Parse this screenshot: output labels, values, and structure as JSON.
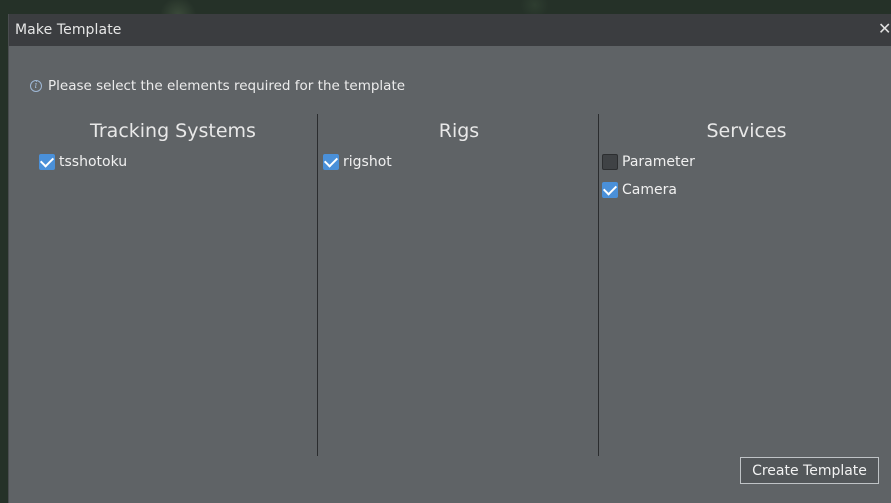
{
  "dialog": {
    "title": "Make Template",
    "close_glyph": "✕"
  },
  "info": {
    "icon": "info-icon",
    "glyph": "i",
    "text": "Please select the elements required for the template"
  },
  "columns": [
    {
      "header": "Tracking Systems",
      "items": [
        {
          "label": "tsshotoku",
          "checked": true
        }
      ]
    },
    {
      "header": "Rigs",
      "items": [
        {
          "label": "rigshot",
          "checked": true
        }
      ]
    },
    {
      "header": "Services",
      "items": [
        {
          "label": "Parameter",
          "checked": false
        },
        {
          "label": "Camera",
          "checked": true
        }
      ]
    }
  ],
  "actions": {
    "create_label": "Create Template"
  },
  "colors": {
    "dialog_bg": "#5f6366",
    "titlebar_bg": "#3b3d40",
    "checkbox_checked": "#4a90d9",
    "checkbox_unchecked": "#3f4245",
    "divider": "#2a2c2e"
  }
}
